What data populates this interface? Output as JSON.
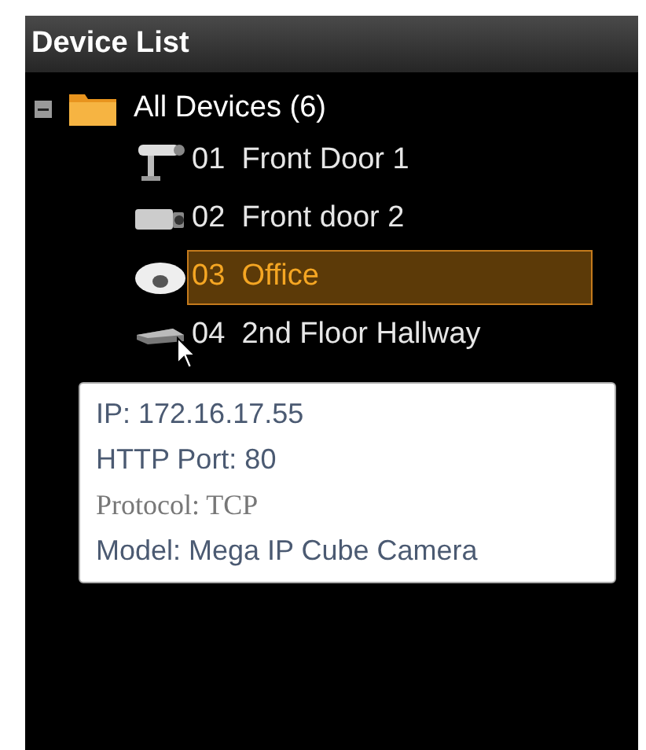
{
  "panel": {
    "title": "Device List"
  },
  "tree": {
    "label": "All Devices (6)",
    "expanded": true,
    "children": [
      {
        "number": "01",
        "name": "Front Door 1",
        "kind": "bullet",
        "selected": false
      },
      {
        "number": "02",
        "name": "Front door 2",
        "kind": "box",
        "selected": false
      },
      {
        "number": "03",
        "name": "Office",
        "kind": "dome",
        "selected": true
      },
      {
        "number": "04",
        "name": "2nd Floor Hallway",
        "kind": "cube",
        "selected": false
      }
    ]
  },
  "tooltip": {
    "lines": [
      {
        "text": "IP: 172.16.17.55",
        "kind": "normal"
      },
      {
        "text": "HTTP Port: 80",
        "kind": "normal"
      },
      {
        "text": "Protocol: TCP",
        "kind": "faded"
      },
      {
        "text": "Model: Mega IP Cube Camera",
        "kind": "normal"
      }
    ]
  }
}
